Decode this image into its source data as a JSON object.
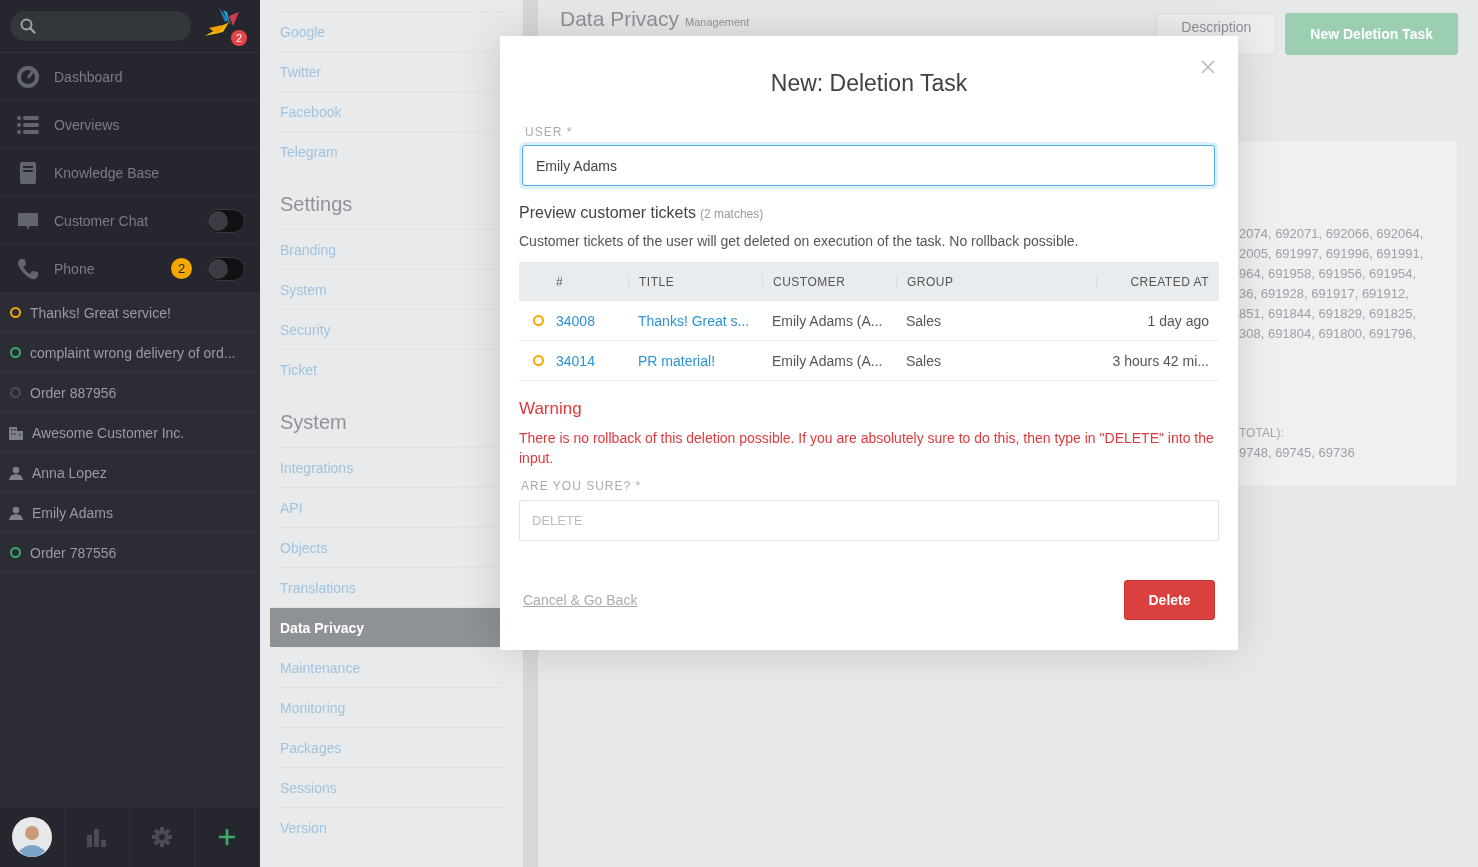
{
  "sidebar": {
    "logo_badge": "2",
    "nav": [
      {
        "label": "Dashboard"
      },
      {
        "label": "Overviews"
      },
      {
        "label": "Knowledge Base"
      },
      {
        "label": "Customer Chat",
        "toggle": {
          "on": false
        }
      },
      {
        "label": "Phone",
        "badge": "2",
        "toggle": {
          "on": false
        }
      }
    ],
    "tasks": [
      {
        "kind": "ticket",
        "label": "Thanks! Great service!",
        "color": "#f7a800"
      },
      {
        "kind": "ticket",
        "label": "complaint wrong delivery of ord...",
        "color": "#38ad69"
      },
      {
        "kind": "ticket",
        "label": "Order 887956",
        "color": "#4a4d55"
      },
      {
        "kind": "organization",
        "label": "Awesome Customer Inc."
      },
      {
        "kind": "user",
        "label": "Anna Lopez"
      },
      {
        "kind": "user",
        "label": "Emily Adams"
      },
      {
        "kind": "ticket",
        "label": "Order 787556",
        "color": "#38ad69"
      }
    ]
  },
  "settings_menu": [
    {
      "items": [
        {
          "label": "Google",
          "selected": false
        },
        {
          "label": "Twitter",
          "selected": false
        },
        {
          "label": "Facebook",
          "selected": false
        },
        {
          "label": "Telegram",
          "selected": false
        }
      ]
    },
    {
      "heading": "Settings",
      "items": [
        {
          "label": "Branding",
          "selected": false
        },
        {
          "label": "System",
          "selected": false
        },
        {
          "label": "Security",
          "selected": false
        },
        {
          "label": "Ticket",
          "selected": false
        }
      ]
    },
    {
      "heading": "System",
      "items": [
        {
          "label": "Integrations",
          "selected": false
        },
        {
          "label": "API",
          "selected": false
        },
        {
          "label": "Objects",
          "selected": false
        },
        {
          "label": "Translations",
          "selected": false
        },
        {
          "label": "Data Privacy",
          "selected": true
        },
        {
          "label": "Maintenance",
          "selected": false
        },
        {
          "label": "Monitoring",
          "selected": false
        },
        {
          "label": "Packages",
          "selected": false
        },
        {
          "label": "Sessions",
          "selected": false
        },
        {
          "label": "Version",
          "selected": false
        }
      ]
    }
  ],
  "page": {
    "title": "Data Privacy",
    "subtitle": "Management",
    "buttons": [
      {
        "label": "Description",
        "kind": "secondary"
      },
      {
        "label": "New Deletion Task",
        "kind": "primary"
      }
    ],
    "card": {
      "lines": [
        "2074, 692071, 692066, 692064,",
        "2005, 691997, 691996, 691991,",
        "964, 691958, 691956, 691954,",
        "36, 691928, 691917, 691912,",
        "851, 691844, 691829, 691825,",
        "308, 691804, 691800, 691796,"
      ],
      "label": "TOTAL):",
      "line": "9748, 69745, 69736"
    }
  },
  "dialog": {
    "title": "New: Deletion Task",
    "user_label": "USER *",
    "user_value": "Emily Adams",
    "preview_heading": "Preview customer tickets",
    "preview_count": "(2 matches)",
    "preview_note": "Customer tickets of the user will get deleted on execution of the task. No rollback possible.",
    "columns": [
      "#",
      "TITLE",
      "CUSTOMER",
      "GROUP",
      "CREATED AT"
    ],
    "rows": [
      {
        "color": "#f7a800",
        "cells": [
          "34008",
          "Thanks! Great s...",
          "Emily Adams (A...",
          "Sales",
          "1 day ago"
        ]
      },
      {
        "color": "#f7a800",
        "cells": [
          "34014",
          "PR material!",
          "Emily Adams (A...",
          "Sales",
          "3 hours 42 mi..."
        ]
      }
    ],
    "warning_heading": "Warning",
    "warning_text": "There is no rollback of this deletion possible. If you are absolutely sure to do this, then type in \"DELETE\" into the input.",
    "confirm_label": "ARE YOU SURE? *",
    "confirm_placeholder": "DELETE",
    "cancel": "Cancel & Go Back",
    "submit": "Delete"
  }
}
